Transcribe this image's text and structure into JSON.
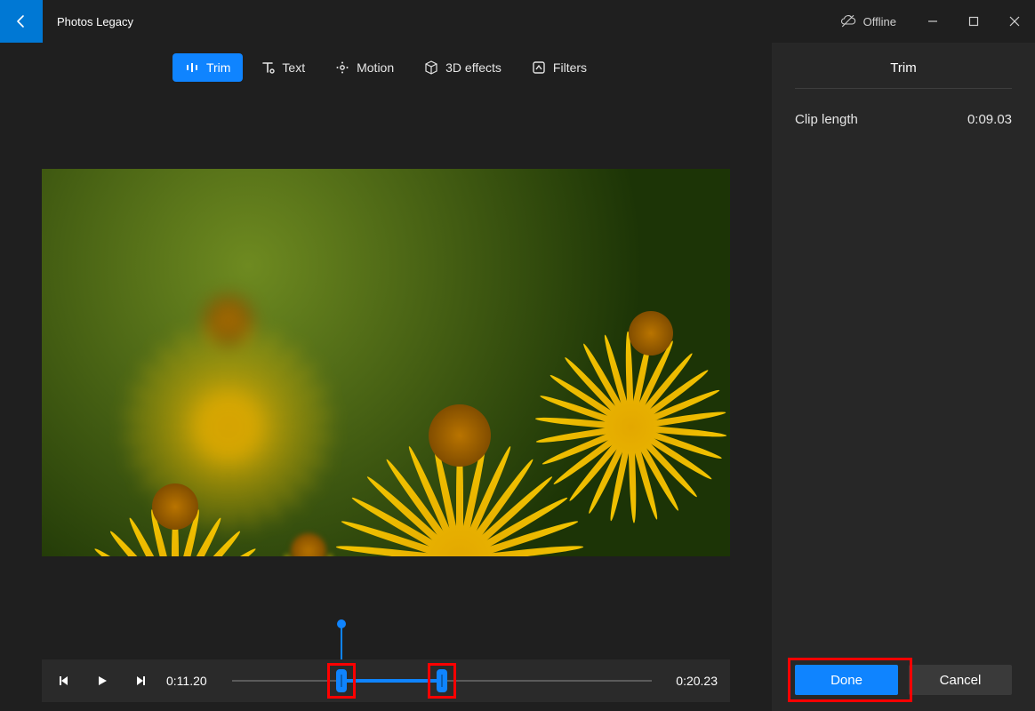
{
  "app_title": "Photos Legacy",
  "offline_label": "Offline",
  "tabs": [
    {
      "label": "Trim",
      "active": true
    },
    {
      "label": "Text",
      "active": false
    },
    {
      "label": "Motion",
      "active": false
    },
    {
      "label": "3D effects",
      "active": false
    },
    {
      "label": "Filters",
      "active": false
    }
  ],
  "playback": {
    "current_time": "0:11.20",
    "duration": "0:20.23",
    "trim_start_pct": 26,
    "trim_end_pct": 50,
    "playhead_pct": 26
  },
  "side_panel": {
    "title": "Trim",
    "clip_length_label": "Clip length",
    "clip_length_value": "0:09.03",
    "done_label": "Done",
    "cancel_label": "Cancel"
  },
  "colors": {
    "accent": "#0f84ff",
    "highlight_box": "#ff0000"
  }
}
